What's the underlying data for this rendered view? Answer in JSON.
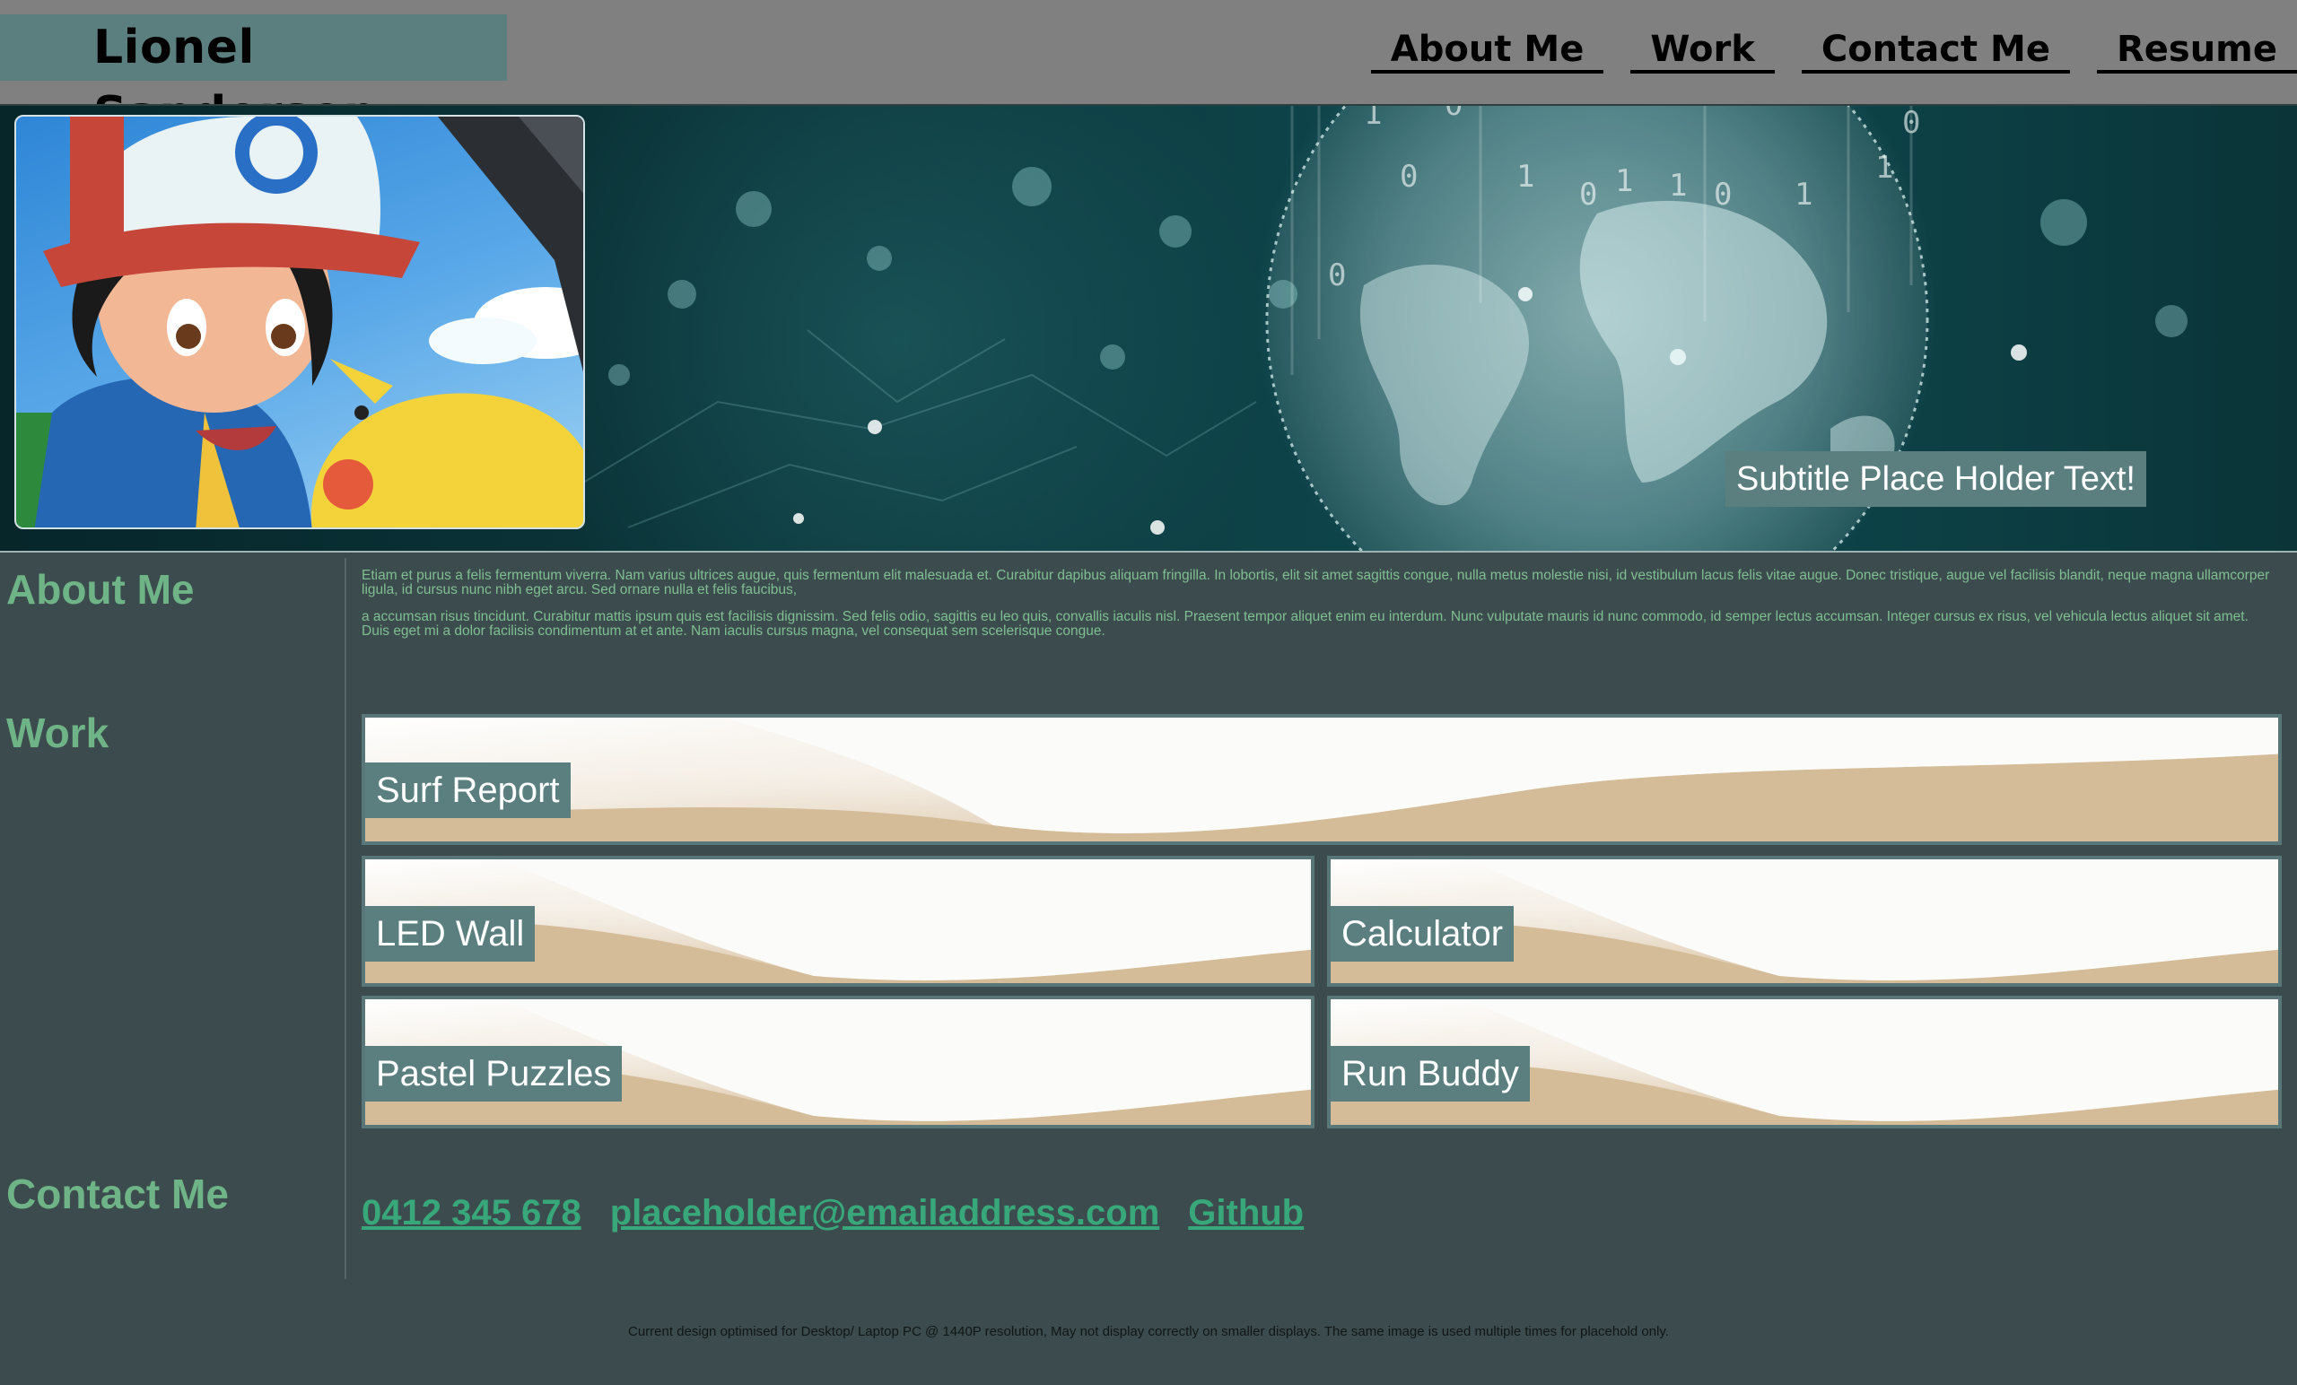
{
  "header": {
    "brand": "Lionel Sanderson",
    "nav": [
      "About Me",
      "Work",
      "Contact Me",
      "Resume"
    ]
  },
  "hero": {
    "subtitle": "Subtitle Place Holder Text!"
  },
  "sections": {
    "about_heading": "About Me",
    "work_heading": "Work",
    "contact_heading": "Contact Me"
  },
  "about": {
    "paragraphs": [
      "Etiam et purus a felis fermentum viverra. Nam varius ultrices augue, quis fermentum elit malesuada et. Curabitur dapibus aliquam fringilla. In lobortis, elit sit amet sagittis congue, nulla metus molestie nisi, id vestibulum lacus felis vitae augue. Donec tristique, augue vel facilisis blandit, neque magna ullamcorper ligula, id cursus nunc nibh eget arcu. Sed ornare nulla et felis faucibus,",
      "a accumsan risus tincidunt. Curabitur mattis ipsum quis est facilisis dignissim. Sed felis odio, sagittis eu leo quis, convallis iaculis nisl. Praesent tempor aliquet enim eu interdum. Nunc vulputate mauris id nunc commodo, id semper lectus accumsan. Integer cursus ex risus, vel vehicula lectus aliquet sit amet. Duis eget mi a dolor facilisis condimentum at et ante. Nam iaculis cursus magna, vel consequat sem scelerisque congue."
    ]
  },
  "work": {
    "projects": [
      "Surf Report",
      "LED Wall",
      "Calculator",
      "Pastel Puzzles",
      "Run Buddy"
    ]
  },
  "contact": {
    "phone": "0412 345 678",
    "email": "placeholder@emailaddress.com",
    "github": "Github"
  },
  "footer": {
    "note": "Current design optimised for Desktop/ Laptop PC @ 1440P resolution, May not display correctly on smaller displays. The same image is used multiple times for placehold only."
  },
  "colors": {
    "page_bg": "#3c4b4d",
    "header_bg": "#808080",
    "accent_teal": "#5b7f7f",
    "heading_green": "#6fb487",
    "link_green": "#38a87a"
  }
}
